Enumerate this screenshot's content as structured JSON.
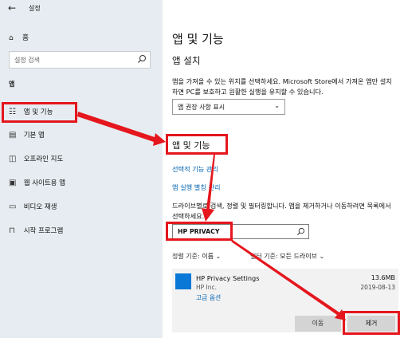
{
  "window": {
    "title": "설정"
  },
  "sidebar": {
    "home": "홈",
    "search_placeholder": "설정 검색",
    "section": "앱",
    "items": [
      {
        "label": "앱 및 기능",
        "icon": "apps-features-icon"
      },
      {
        "label": "기본 앱",
        "icon": "default-apps-icon"
      },
      {
        "label": "오프라인 지도",
        "icon": "offline-maps-icon"
      },
      {
        "label": "웹 사이트용 앱",
        "icon": "apps-for-websites-icon"
      },
      {
        "label": "비디오 재생",
        "icon": "video-playback-icon"
      },
      {
        "label": "시작 프로그램",
        "icon": "startup-icon"
      }
    ]
  },
  "main": {
    "title": "앱 및 기능",
    "install": {
      "heading": "앱 설치",
      "description": "앱을 가져올 수 있는 위치를 선택하세요. Microsoft Store에서 가져온 앱만 설치하면 PC를 보호하고 원활한 실행을 유지할 수 있습니다.",
      "dropdown_value": "앱 권장 사항 표시"
    },
    "features": {
      "heading": "앱 및 기능",
      "link_optional": "선택적 기능 관리",
      "link_aliases": "앱 실행 별칭 관리",
      "description": "드라이브별로 검색, 정렬 및 필터링합니다. 앱을 제거하거나 이동하려면 목록에서 선택하세요.",
      "search_value": "HP PRIVACY",
      "sort_label": "정렬 기준:",
      "sort_value": "이름",
      "filter_label": "필터 기준:",
      "filter_value": "모든 드라이브"
    },
    "app": {
      "name": "HP Privacy Settings",
      "publisher": "HP Inc.",
      "advanced": "고급 옵션",
      "size": "13.6MB",
      "date": "2019-08-13",
      "move_label": "이동",
      "uninstall_label": "제거"
    }
  },
  "colors": {
    "annotation": "#e5161d",
    "link": "#0063b1",
    "sidebar_bg": "#e6ecf1"
  }
}
